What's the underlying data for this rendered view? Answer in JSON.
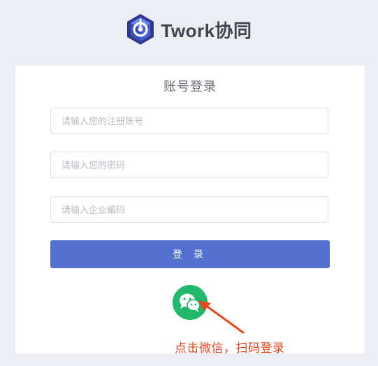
{
  "brand": {
    "name": "Twork协同",
    "logo_icon": "twork-cube-logo"
  },
  "login": {
    "title": "账号登录",
    "account_placeholder": "请输入您的注册账号",
    "password_placeholder": "请输入您的密码",
    "company_placeholder": "请输入企业编码",
    "submit_label": "登 录",
    "wechat_icon": "wechat-icon"
  },
  "annotation": {
    "hint": "点击微信，扫码登录",
    "arrow_icon": "arrow-icon"
  },
  "colors": {
    "background": "#eceef3",
    "primary": "#5470cf",
    "wechat": "#20b86a",
    "annotation": "#e8471d"
  }
}
